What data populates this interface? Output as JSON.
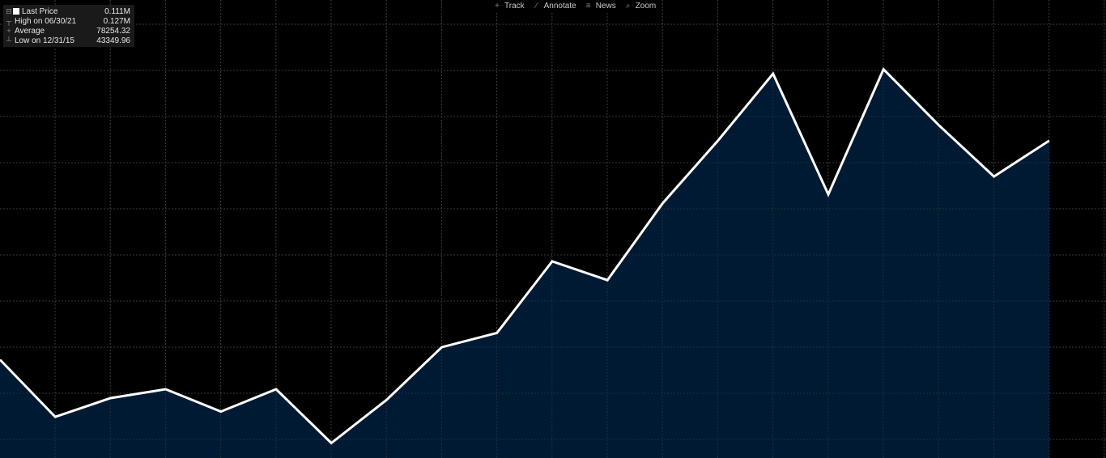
{
  "toolbar": {
    "track_label": "Track",
    "annotate_label": "Annotate",
    "news_label": "News",
    "zoom_label": "Zoom"
  },
  "legend": {
    "last_price_label": "Last Price",
    "last_price_value": "0.111M",
    "high_label": "High on 06/30/21",
    "high_value": "0.127M",
    "average_label": "Average",
    "average_value": "78254.32",
    "low_label": "Low on 12/31/15",
    "low_value": "43349.96"
  },
  "colors": {
    "background": "#000000",
    "line": "#ffffff",
    "area_fill": "#001c38",
    "grid": "#3a3a3a"
  },
  "chart_data": {
    "type": "area",
    "x_index": [
      0,
      1,
      2,
      3,
      4,
      5,
      6,
      7,
      8,
      9,
      10,
      11,
      12,
      13,
      14,
      15,
      16,
      17,
      18,
      19,
      20
    ],
    "values": [
      62000,
      49200,
      53400,
      55400,
      50400,
      55400,
      43350,
      53000,
      64800,
      68000,
      84000,
      79800,
      97000,
      111000,
      126000,
      99000,
      127000,
      114500,
      103000,
      111000
    ],
    "ylim": [
      40000,
      142500
    ],
    "grid": true,
    "legend_position": "top-left"
  }
}
